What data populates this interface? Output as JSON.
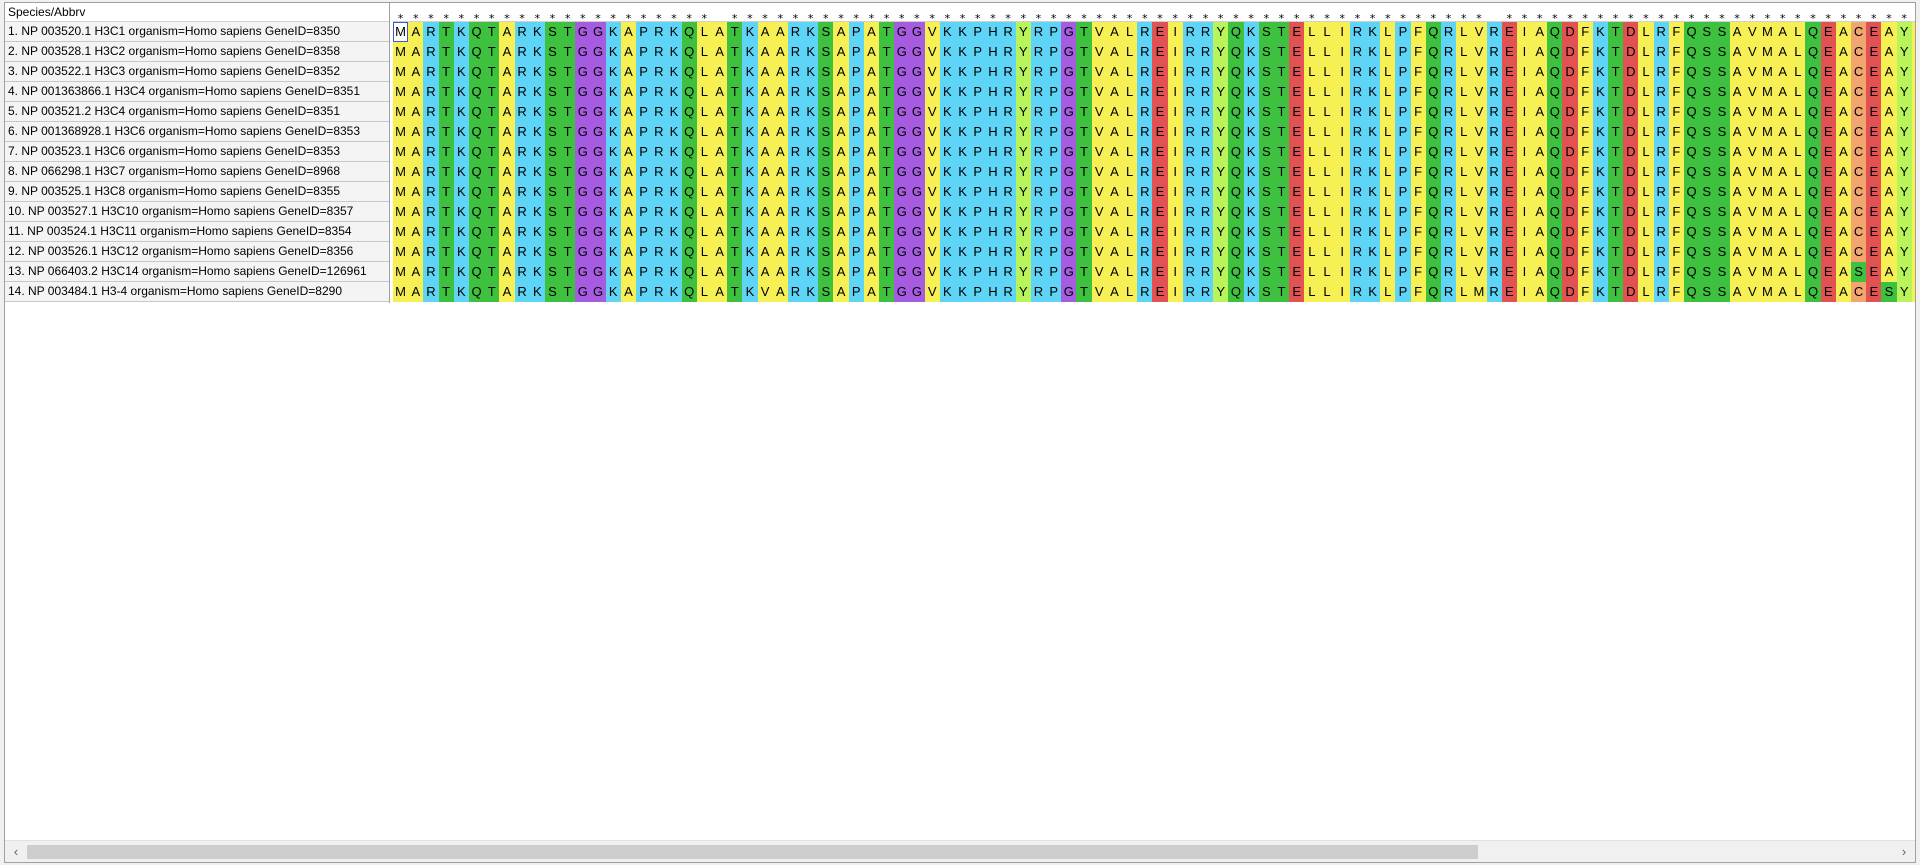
{
  "header": {
    "species_label": "Species/Abbrv"
  },
  "consensus": "********************* ************************************************** ********************************** ********** *** * *",
  "rows": [
    {
      "label": "1. NP 003520.1 H3C1 organism=Homo sapiens GeneID=8350",
      "seq": "MARTKQTARKSTGGKAPRKQLATKAARKSAPATGGVKKPHRYRPGTVALREIRRYQKSTELLIRKLPFQRLVREIAQDFKTDLRFQSSAVMALQEACEAYLV"
    },
    {
      "label": "2. NP 003528.1 H3C2 organism=Homo sapiens GeneID=8358",
      "seq": "MARTKQTARKSTGGKAPRKQLATKAARKSAPATGGVKKPHRYRPGTVALREIRRYQKSTELLIRKLPFQRLVREIAQDFKTDLRFQSSAVMALQEACEAYLV"
    },
    {
      "label": "3. NP 003522.1 H3C3 organism=Homo sapiens GeneID=8352",
      "seq": "MARTKQTARKSTGGKAPRKQLATKAARKSAPATGGVKKPHRYRPGTVALREIRRYQKSTELLIRKLPFQRLVREIAQDFKTDLRFQSSAVMALQEACEAYLV"
    },
    {
      "label": "4. NP 001363866.1 H3C4 organism=Homo sapiens GeneID=8351",
      "seq": "MARTKQTARKSTGGKAPRKQLATKAARKSAPATGGVKKPHRYRPGTVALREIRRYQKSTELLIRKLPFQRLVREIAQDFKTDLRFQSSAVMALQEACEAYLV"
    },
    {
      "label": "5. NP 003521.2 H3C4 organism=Homo sapiens GeneID=8351",
      "seq": "MARTKQTARKSTGGKAPRKQLATKAARKSAPATGGVKKPHRYRPGTVALREIRRYQKSTELLIRKLPFQRLVREIAQDFKTDLRFQSSAVMALQEACEAYLV"
    },
    {
      "label": "6. NP 001368928.1 H3C6 organism=Homo sapiens GeneID=8353",
      "seq": "MARTKQTARKSTGGKAPRKQLATKAARKSAPATGGVKKPHRYRPGTVALREIRRYQKSTELLIRKLPFQRLVREIAQDFKTDLRFQSSAVMALQEACEAYLV"
    },
    {
      "label": "7. NP 003523.1 H3C6 organism=Homo sapiens GeneID=8353",
      "seq": "MARTKQTARKSTGGKAPRKQLATKAARKSAPATGGVKKPHRYRPGTVALREIRRYQKSTELLIRKLPFQRLVREIAQDFKTDLRFQSSAVMALQEACEAYLV"
    },
    {
      "label": "8. NP 066298.1 H3C7 organism=Homo sapiens GeneID=8968",
      "seq": "MARTKQTARKSTGGKAPRKQLATKAARKSAPATGGVKKPHRYRPGTVALREIRRYQKSTELLIRKLPFQRLVREIAQDFKTDLRFQSSAVMALQEACEAYLV"
    },
    {
      "label": "9. NP 003525.1 H3C8 organism=Homo sapiens GeneID=8355",
      "seq": "MARTKQTARKSTGGKAPRKQLATKAARKSAPATGGVKKPHRYRPGTVALREIRRYQKSTELLIRKLPFQRLVREIAQDFKTDLRFQSSAVMALQEACEAYLV"
    },
    {
      "label": "10. NP 003527.1 H3C10 organism=Homo sapiens GeneID=8357",
      "seq": "MARTKQTARKSTGGKAPRKQLATKAARKSAPATGGVKKPHRYRPGTVALREIRRYQKSTELLIRKLPFQRLVREIAQDFKTDLRFQSSAVMALQEACEAYLV"
    },
    {
      "label": "11. NP 003524.1 H3C11 organism=Homo sapiens GeneID=8354",
      "seq": "MARTKQTARKSTGGKAPRKQLATKAARKSAPATGGVKKPHRYRPGTVALREIRRYQKSTELLIRKLPFQRLVREIAQDFKTDLRFQSSAVMALQEACEAYLV"
    },
    {
      "label": "12. NP 003526.1 H3C12 organism=Homo sapiens GeneID=8356",
      "seq": "MARTKQTARKSTGGKAPRKQLATKAARKSAPATGGVKKPHRYRPGTVALREIRRYQKSTELLIRKLPFQRLVREIAQDFKTDLRFQSSAVMALQEACEAYLV"
    },
    {
      "label": "13. NP 066403.2 H3C14 organism=Homo sapiens GeneID=126961",
      "seq": "MARTKQTARKSTGGKAPRKQLATKAARKSAPATGGVKKPHRYRPGTVALREIRRYQKSTELLIRKLPFQRLVREIAQDFKTDLRFQSSAVMALQEASEAYLV"
    },
    {
      "label": "14. NP 003484.1 H3-4 organism=Homo sapiens GeneID=8290",
      "seq": "MARTKQTARKSTGGKAPRKQLATKVARKSAPATGGVKKPHRYRPGTVALREIRRYQKSTELLIRKLPFQRLMREIAQDFKTDLRFQSSAVMALQEACESYLV"
    }
  ],
  "colors": {
    "A": "#f7f055",
    "V": "#f7f055",
    "L": "#f7f055",
    "I": "#f7f055",
    "M": "#f7f055",
    "F": "#f7f055",
    "K": "#5ed5f7",
    "R": "#5ed5f7",
    "H": "#5ed5f7",
    "T": "#3ec13e",
    "Q": "#3ec13e",
    "S": "#3ec13e",
    "N": "#3ec13e",
    "G": "#a55ce0",
    "P": "#5ed5f7",
    "Y": "#b8f45a",
    "W": "#5ed5f7",
    "D": "#e25252",
    "E": "#e25252",
    "C": "#f2a66e"
  },
  "selected_cell": {
    "row": 0,
    "col": 0
  },
  "scrollbar": {
    "left_icon": "‹",
    "right_icon": "›",
    "position": 0.0,
    "visible_fraction": 0.78
  }
}
